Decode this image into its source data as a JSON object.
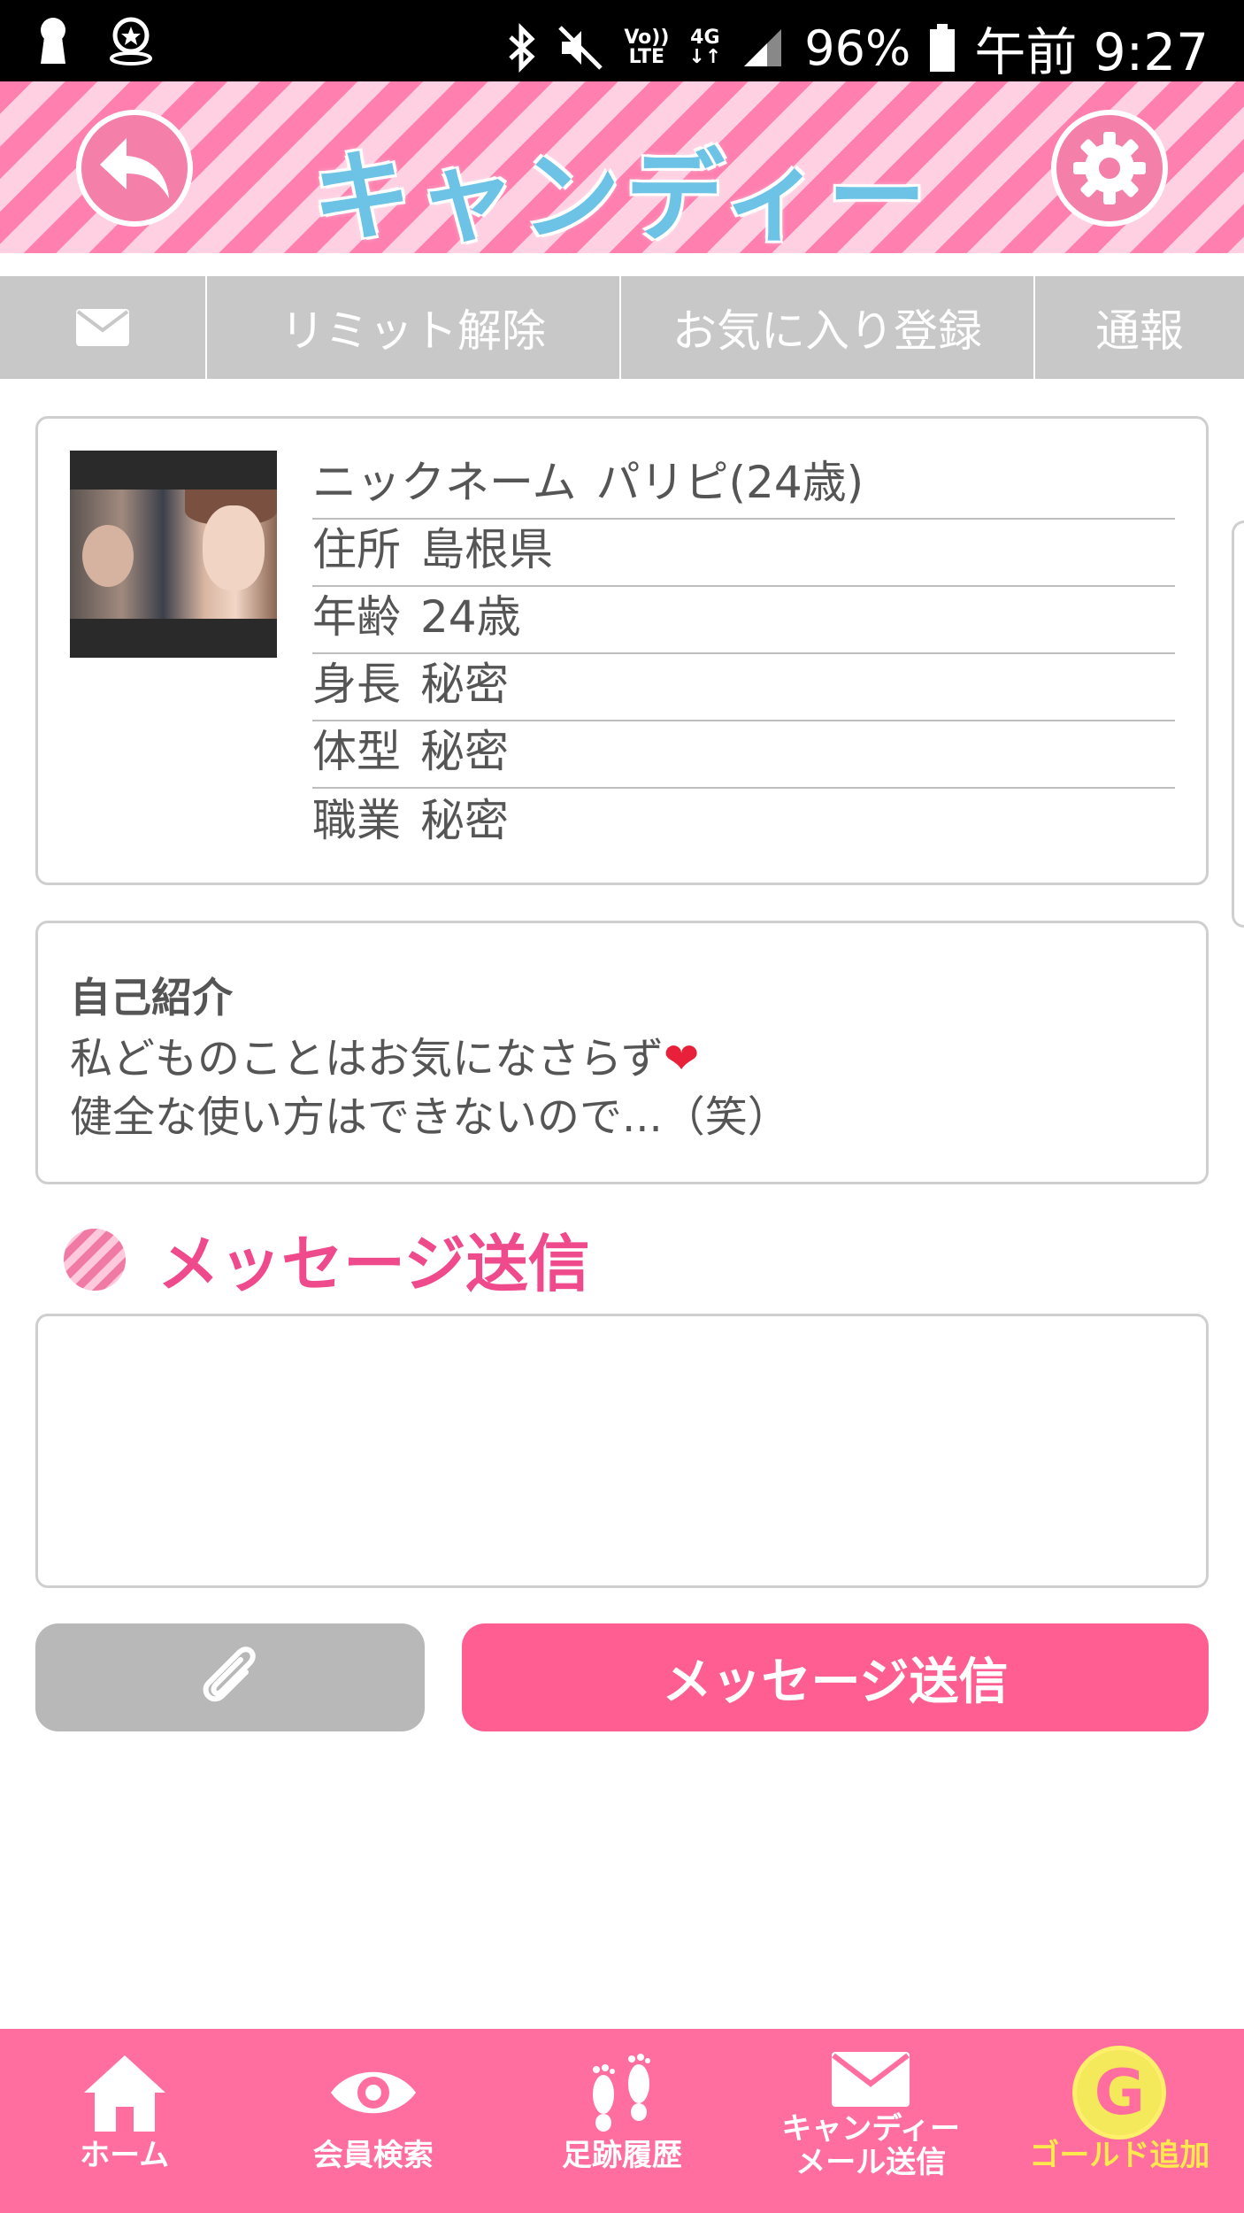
{
  "status_bar": {
    "lte_top": "Vo))",
    "lte_bottom": "LTE",
    "network": "4G",
    "battery": "96%",
    "time": "午前 9:27"
  },
  "header": {
    "title": "キャンディー"
  },
  "tabs": [
    {
      "label": ""
    },
    {
      "label": "リミット解除"
    },
    {
      "label": "お気に入り登録"
    },
    {
      "label": "通報"
    }
  ],
  "profile": {
    "rows": [
      {
        "key": "ニックネーム",
        "value": "パリピ(24歳)"
      },
      {
        "key": "住所",
        "value": "島根県"
      },
      {
        "key": "年齢",
        "value": "24歳"
      },
      {
        "key": "身長",
        "value": "秘密"
      },
      {
        "key": "体型",
        "value": "秘密"
      },
      {
        "key": "職業",
        "value": "秘密"
      }
    ]
  },
  "intro": {
    "title": "自己紹介",
    "line1": "私どものことはお気になさらず",
    "heart": "❤",
    "line2": "健全な使い方はできないので...（笑）"
  },
  "message": {
    "heading": "メッセージ送信",
    "placeholder": "",
    "send_label": "メッセージ送信"
  },
  "bottom_nav": [
    {
      "label": "ホーム",
      "icon": "home-icon"
    },
    {
      "label": "会員検索",
      "icon": "eye-icon"
    },
    {
      "label": "足跡履歴",
      "icon": "footprints-icon"
    },
    {
      "label": "キャンディー\nメール送信",
      "icon": "mail-icon"
    },
    {
      "label": "ゴールド追加",
      "icon": "gold-coin-icon",
      "coin_letter": "G"
    }
  ],
  "colors": {
    "accent_pink": "#ff5e93",
    "heading_pink": "#ef4a8c",
    "nav_pink": "#ff6e9f",
    "tab_gray": "#c8c8c8",
    "gold": "#ffe94d"
  }
}
